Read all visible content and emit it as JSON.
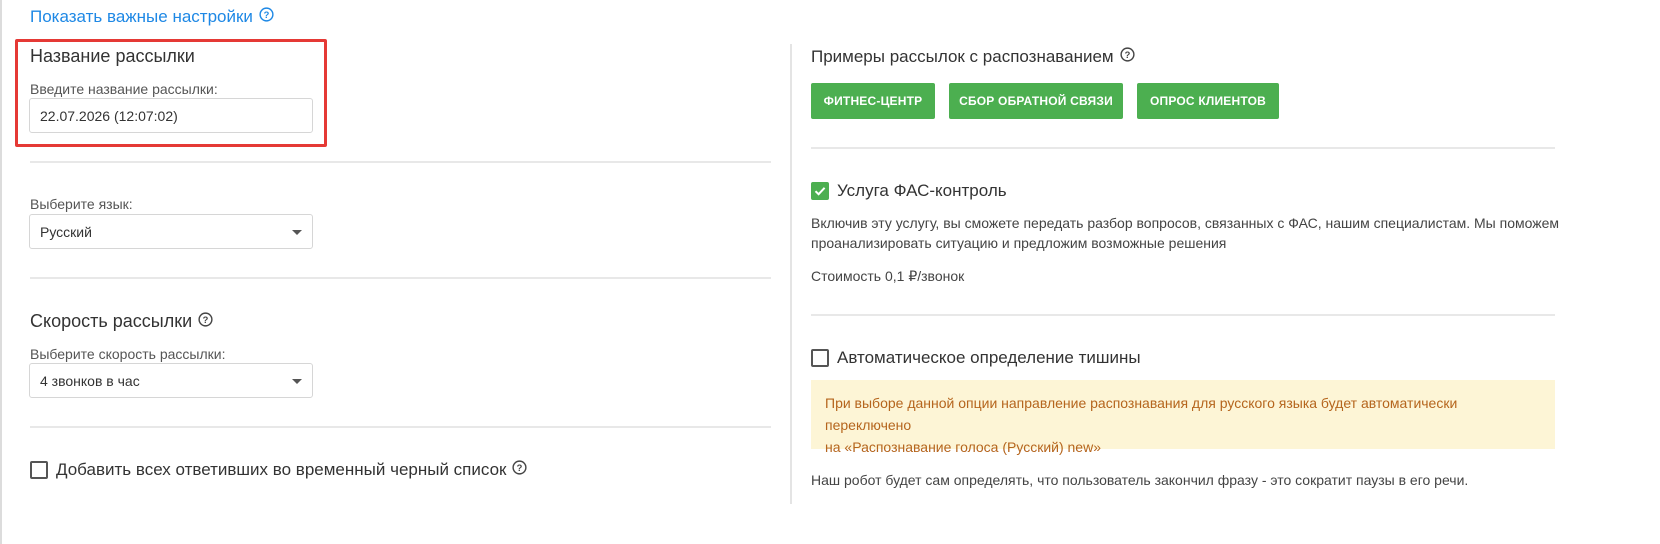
{
  "top_link": {
    "label": "Показать важные настройки"
  },
  "left": {
    "name_section": {
      "title": "Название рассылки",
      "label": "Введите название рассылки:",
      "value": "22.07.2026 (12:07:02)"
    },
    "language": {
      "label": "Выберите язык:",
      "selected": "Русский"
    },
    "speed": {
      "title": "Скорость рассылки",
      "label": "Выберите скорость рассылки:",
      "selected": "4 звонков в час"
    },
    "blacklist": {
      "label": "Добавить всех ответивших во временный черный список",
      "checked": false
    }
  },
  "right": {
    "examples": {
      "title": "Примеры рассылок с распознаванием",
      "buttons": [
        "ФИТНЕС-ЦЕНТР",
        "СБОР ОБРАТНОЙ СВЯЗИ",
        "ОПРОС КЛИЕНТОВ"
      ]
    },
    "fas": {
      "label": "Услуга ФАС-контроль",
      "checked": true,
      "description_line1": "Включив эту услугу, вы сможете передать разбор вопросов, связанных с ФАС, нашим специалистам. Мы поможем",
      "description_line2": "проанализировать ситуацию и предложим возможные решения",
      "price": "Стоимость 0,1 ₽/звонок"
    },
    "silence": {
      "label": "Автоматическое определение тишины",
      "checked": false,
      "warning_line1": "При выборе данной опции направление распознавания для русского языка будет автоматически переключено",
      "warning_line2": "на «Распознавание голоса (Русский) new»",
      "note": "Наш робот будет сам определять, что пользователь закончил фразу - это сократит паузы в его речи."
    }
  },
  "colors": {
    "accent_link": "#1e88e5",
    "button_green": "#4caf50",
    "highlight_red": "#e53935",
    "warning_bg": "#fdf5d6",
    "warning_text": "#b5651d"
  }
}
